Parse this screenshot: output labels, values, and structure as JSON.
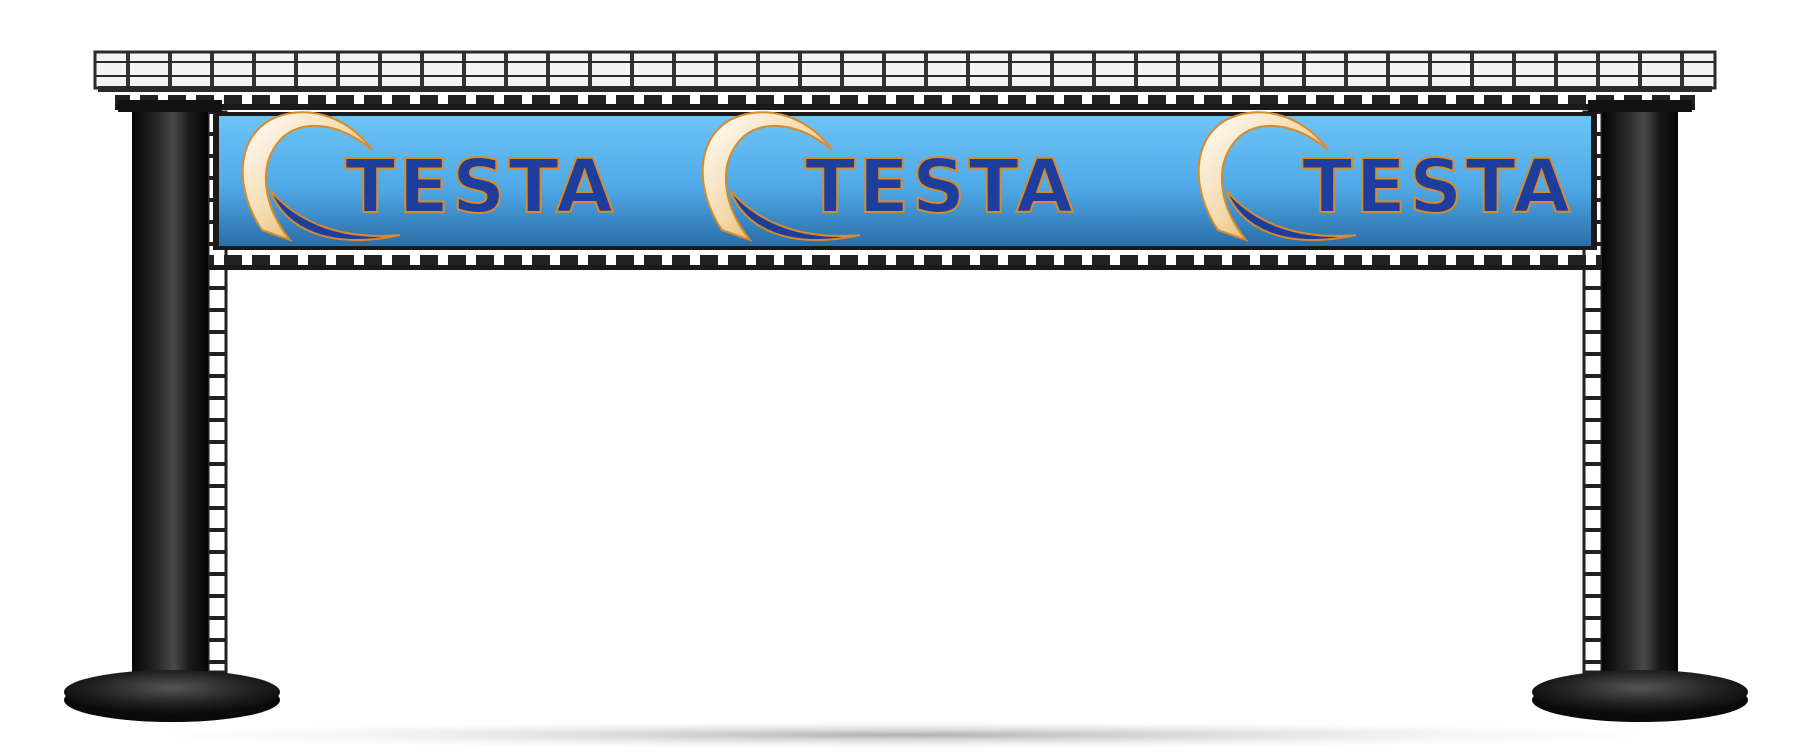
{
  "banner": {
    "logos": [
      {
        "word": "TESTA"
      },
      {
        "word": "TESTA"
      },
      {
        "word": "TESTA"
      }
    ]
  },
  "colors": {
    "banner_light": "#5db9f2",
    "banner_dark": "#2b6ea8",
    "logo_text": "#1d3e9c",
    "logo_outline": "#d98a2a",
    "truss": "#2a2a2a",
    "pillar": "#111111"
  }
}
